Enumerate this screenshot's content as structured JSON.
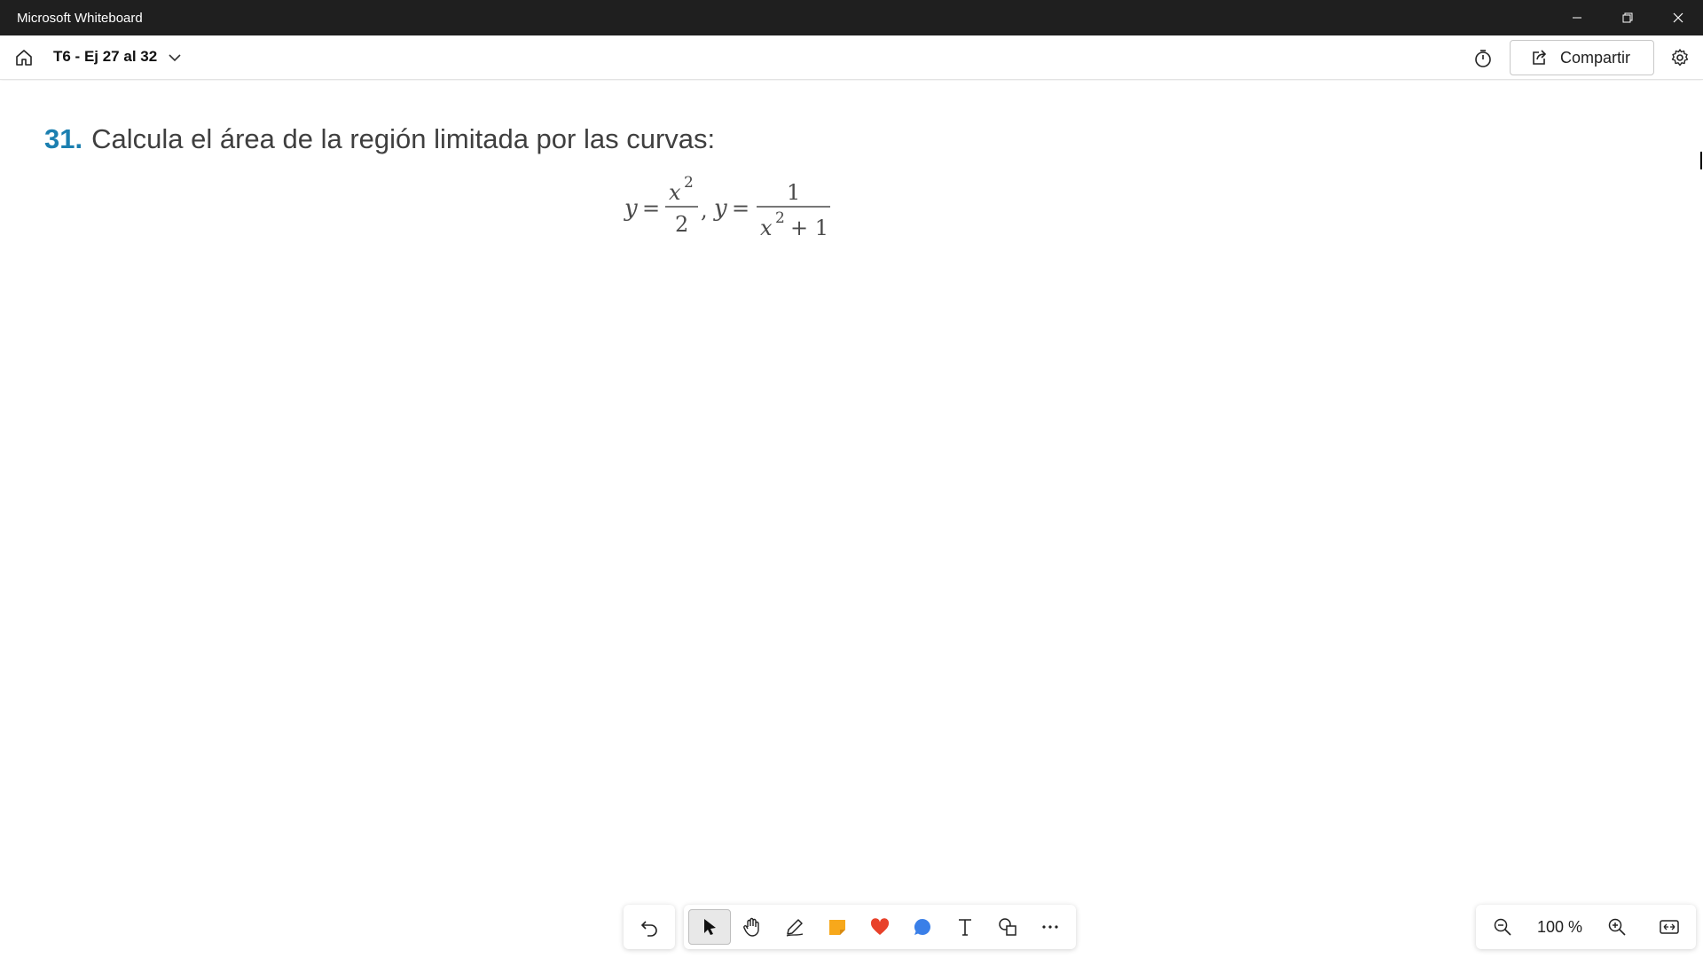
{
  "window": {
    "title": "Microsoft Whiteboard"
  },
  "toolbar": {
    "board_title": "T6 - Ej 27 al 32",
    "share_label": "Compartir"
  },
  "canvas": {
    "problem_number": "31.",
    "problem_text": "Calcula el área de la región limitada por las curvas:",
    "formula": {
      "y1": "y",
      "eq1": "=",
      "num1_base": "x",
      "num1_exp": "2",
      "den1": "2",
      "comma": ",",
      "y2": "y",
      "eq2": "=",
      "num2": "1",
      "den2_base": "x",
      "den2_exp": "2",
      "den2_rest": "+ 1"
    }
  },
  "zoom": {
    "level": "100 %"
  },
  "icons": {
    "home": "home-icon",
    "chevron": "chevron-down-icon",
    "timer": "timer-icon",
    "share": "share-icon",
    "settings": "gear-icon",
    "undo": "undo-icon",
    "select": "select-arrow-icon",
    "hand": "hand-icon",
    "pen": "pen-icon",
    "note": "sticky-note-icon",
    "reaction": "heart-icon",
    "chat": "chat-bubble-icon",
    "text": "text-icon",
    "shapes": "shapes-icon",
    "more": "more-icon",
    "zoom_out": "zoom-out-icon",
    "zoom_in": "zoom-in-icon",
    "fit": "fit-screen-icon"
  },
  "colors": {
    "accent_number": "#1b7fb0",
    "sticky": "#f7a81b",
    "heart": "#e8412a",
    "chat": "#3a7fe8"
  }
}
